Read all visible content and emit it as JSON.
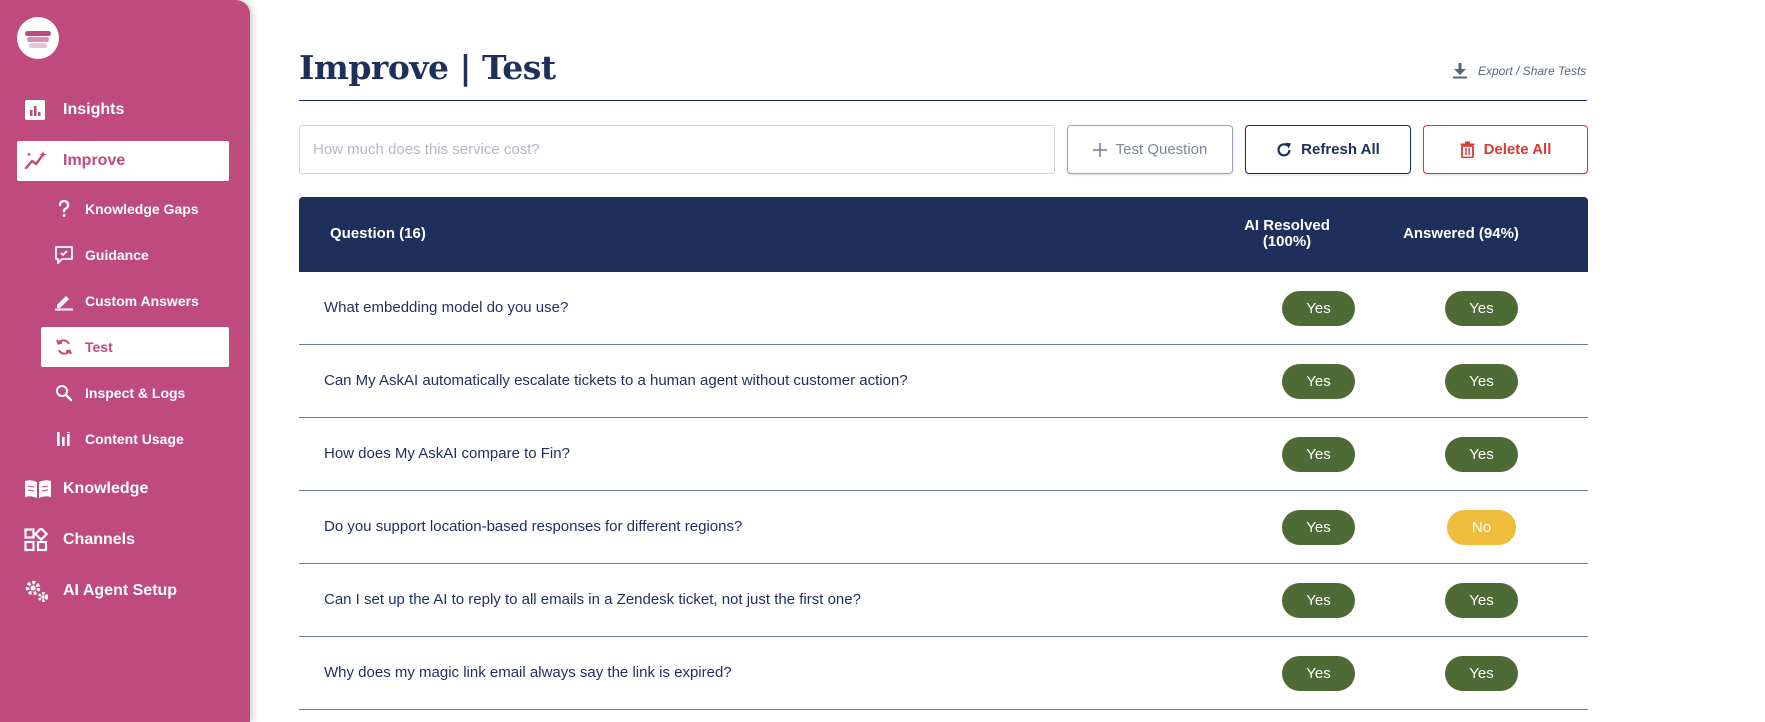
{
  "sidebar": {
    "logo": "myaskai-logo",
    "nav": [
      {
        "label": "Insights",
        "icon": "bar-chart-icon"
      },
      {
        "label": "Improve",
        "icon": "magic-wand-icon",
        "active": true
      },
      {
        "label": "Knowledge",
        "icon": "open-book-icon"
      },
      {
        "label": "Channels",
        "icon": "apps-grid-icon"
      },
      {
        "label": "AI Agent Setup",
        "icon": "gears-icon"
      }
    ],
    "subnav": [
      {
        "label": "Knowledge Gaps",
        "icon": "question-mark-icon"
      },
      {
        "label": "Guidance",
        "icon": "chat-check-icon"
      },
      {
        "label": "Custom Answers",
        "icon": "pencil-icon"
      },
      {
        "label": "Test",
        "icon": "refresh-cycle-icon",
        "active": true
      },
      {
        "label": "Inspect & Logs",
        "icon": "magnifier-icon"
      },
      {
        "label": "Content Usage",
        "icon": "usage-bars-icon"
      }
    ]
  },
  "page": {
    "title": "Improve | Test",
    "export_label": "Export / Share Tests"
  },
  "toolbar": {
    "search_placeholder": "How much does this service cost?",
    "test_label": "Test Question",
    "refresh_label": "Refresh All",
    "delete_label": "Delete All"
  },
  "table": {
    "headers": {
      "question": "Question (16)",
      "ai_resolved_line1": "AI Resolved",
      "ai_resolved_line2": "(100%)",
      "answered": "Answered (94%)"
    },
    "rows": [
      {
        "question": "What embedding model do you use?",
        "ai_resolved": "Yes",
        "answered": "Yes"
      },
      {
        "question": "Can My AskAI automatically escalate tickets to a human agent without customer action?",
        "ai_resolved": "Yes",
        "answered": "Yes"
      },
      {
        "question": "How does My AskAI compare to Fin?",
        "ai_resolved": "Yes",
        "answered": "Yes"
      },
      {
        "question": "Do you support location-based responses for different regions?",
        "ai_resolved": "Yes",
        "answered": "No"
      },
      {
        "question": "Can I set up the AI to reply to all emails in a Zendesk ticket, not just the first one?",
        "ai_resolved": "Yes",
        "answered": "Yes"
      },
      {
        "question": "Why does my magic link email always say the link is expired?",
        "ai_resolved": "Yes",
        "answered": "Yes"
      }
    ]
  },
  "colors": {
    "sidebar": "#bf4a7e",
    "navy": "#1f2f5c",
    "yes": "#4e6b36",
    "no": "#f0bc3c",
    "danger": "#d63a35"
  }
}
